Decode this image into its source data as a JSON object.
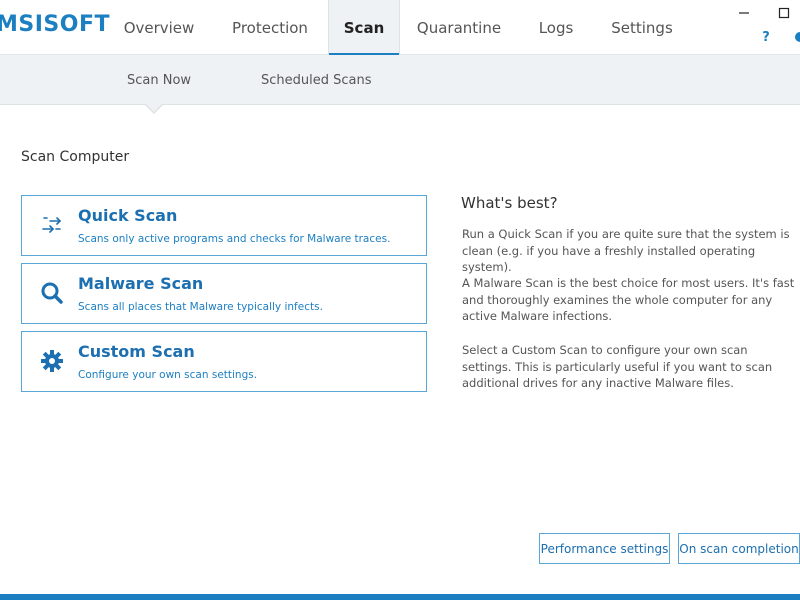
{
  "app": {
    "logo_text": "MSISOFT"
  },
  "nav": {
    "tabs": [
      {
        "label": "Overview"
      },
      {
        "label": "Protection"
      },
      {
        "label": "Scan"
      },
      {
        "label": "Quarantine"
      },
      {
        "label": "Logs"
      },
      {
        "label": "Settings"
      }
    ],
    "active": "Scan"
  },
  "window": {
    "help_label": "?"
  },
  "subnav": {
    "tabs": [
      {
        "label": "Scan Now"
      },
      {
        "label": "Scheduled Scans"
      }
    ],
    "active": "Scan Now"
  },
  "main": {
    "section_title": "Scan Computer",
    "scans": [
      {
        "title": "Quick Scan",
        "description": "Scans only active programs and checks for Malware traces.",
        "icon": "quick-scan-arrows-icon"
      },
      {
        "title": "Malware Scan",
        "description": "Scans all places that Malware typically infects.",
        "icon": "magnifier-icon"
      },
      {
        "title": "Custom Scan",
        "description": "Configure your own scan settings.",
        "icon": "gear-icon"
      }
    ]
  },
  "side": {
    "title": "What's best?",
    "paragraphs": [
      "Run a Quick Scan if you are quite sure that the system is clean (e.g. if you have a freshly installed operating system).",
      "A Malware Scan is the best choice for most users. It's fast and thoroughly examines the whole computer for any active Malware infections.",
      "Select a Custom Scan to configure your own scan settings. This is particularly useful if you want to scan additional drives for any inactive Malware files."
    ]
  },
  "footer": {
    "performance_label": "Performance settings",
    "completion_label": "On scan completion"
  },
  "colors": {
    "accent": "#1c7fc1",
    "title_blue": "#1c6fb0",
    "subbar_bg": "#eef2f4"
  }
}
